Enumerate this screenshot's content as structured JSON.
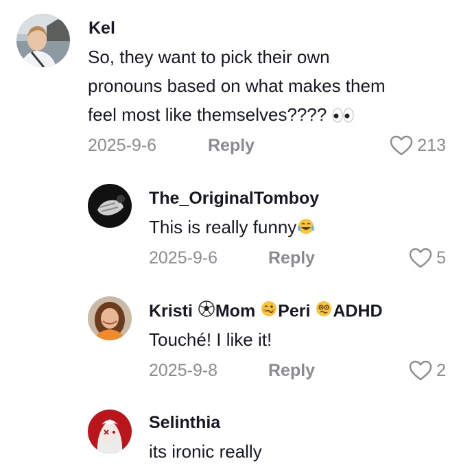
{
  "comments": [
    {
      "username": "Kel",
      "text_lines": [
        "So, they want to pick their own",
        "pronouns based on what makes them",
        "feel most like themselves????"
      ],
      "trailing_emoji": "eyes-emoji",
      "date": "2025-9-6",
      "reply_label": "Reply",
      "likes": "213"
    },
    {
      "username": "The_OriginalTomboy",
      "text": "This is really funny",
      "trailing_emoji": "tears-of-joy-emoji",
      "date": "2025-9-6",
      "reply_label": "Reply",
      "likes": "5"
    },
    {
      "username_parts": [
        "Kristi ",
        "Mom ",
        "Peri ",
        "ADHD"
      ],
      "username_emojis": [
        "soccer-ball-emoji",
        "woozy-face-emoji",
        "dizzy-face-emoji"
      ],
      "text": "Touché! I like it!",
      "date": "2025-9-8",
      "reply_label": "Reply",
      "likes": "2"
    },
    {
      "username": "Selinthia",
      "text": "its ironic really"
    }
  ],
  "icons": {
    "like": "heart-outline-icon"
  },
  "colors": {
    "text": "#161823",
    "secondary": "#8a8b91",
    "background": "#ffffff"
  }
}
